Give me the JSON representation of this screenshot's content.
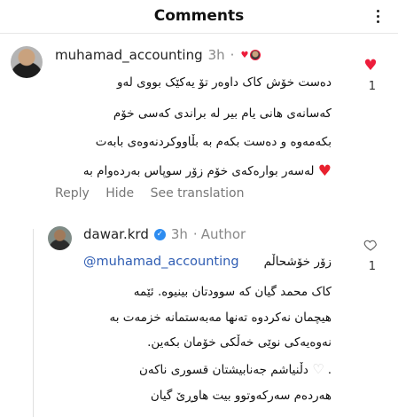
{
  "header": {
    "title": "Comments"
  },
  "comment1": {
    "username": "muhamad_accounting",
    "time": "3h",
    "dot": "·",
    "lines": [
      "دەست خۆش کاک داوەر تۆ یەکێک بووی لەو",
      "کەسانەی هانی یام بیر لە براندی کەسی خۆم",
      "بکەمەوە و دەست بکەم بە بڵاووکردنەوەی بابەت",
      "لەسەر بوارەکەی خۆم زۆر سوپاس بەردەوام بە"
    ],
    "like_count": "1",
    "actions": {
      "reply": "Reply",
      "hide": "Hide",
      "translate": "See translation"
    }
  },
  "comment2": {
    "username": "dawar.krd",
    "time": "3h",
    "dot": "·",
    "author_label": "Author",
    "mention": "@muhamad_accounting",
    "first_line_rtl": "زۆر خۆشحاڵم",
    "lines": [
      "کاک محمد گیان کە سوودتان بینیوە. ئێمە",
      "هیچمان نەکردوە تەنها مەبەستمانە خزمەت بە",
      "نەوەیەکی نوێی خەڵکی خۆمان بکەین.",
      "دڵنیاشم جەنابیشتان قسوری ناکەن",
      "هەردەم سەرکەوتوو بیت هاوڕێ گیان"
    ],
    "like_count": "1"
  },
  "colors": {
    "like_red": "#ed1c3b",
    "mention_blue": "#2f5db3",
    "verified_blue": "#2d8cf0",
    "meta_gray": "#888888"
  }
}
